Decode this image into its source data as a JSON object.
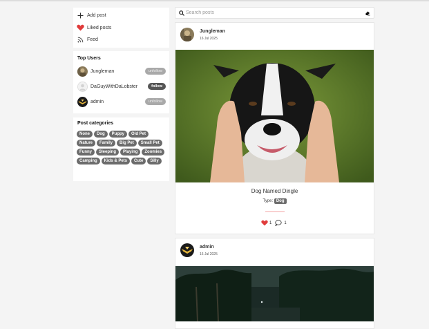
{
  "nav": {
    "add_post": "Add post",
    "liked_posts": "Liked posts",
    "feed": "Feed"
  },
  "top_users": {
    "title": "Top Users",
    "users": [
      {
        "name": "Jungleman",
        "action": "unfollow"
      },
      {
        "name": "DaGuyWithDaLobster",
        "action": "follow"
      },
      {
        "name": "admin",
        "action": "unfollow"
      }
    ]
  },
  "categories": {
    "title": "Post categories",
    "tags": [
      "None",
      "Dog",
      "Puppy",
      "Old Pet",
      "Nature",
      "Family",
      "Big Pet",
      "Small Pet",
      "Funny",
      "Sleeping",
      "Playing",
      "Zoomies",
      "Camping",
      "Kids & Pets",
      "Cute",
      "Silly"
    ]
  },
  "search": {
    "placeholder": "Search posts"
  },
  "posts": [
    {
      "author": "Jungleman",
      "date": "16 Jul 2025",
      "title": "Dog Named Dingle",
      "type_label": "Type:",
      "type": "Dog",
      "likes": "1",
      "comments": "1"
    },
    {
      "author": "admin",
      "date": "16 Jul 2025"
    }
  ],
  "colors": {
    "tag_bg": "#6c6c6c",
    "heart": "#e03c3c",
    "divider": "#f2a3a3"
  }
}
